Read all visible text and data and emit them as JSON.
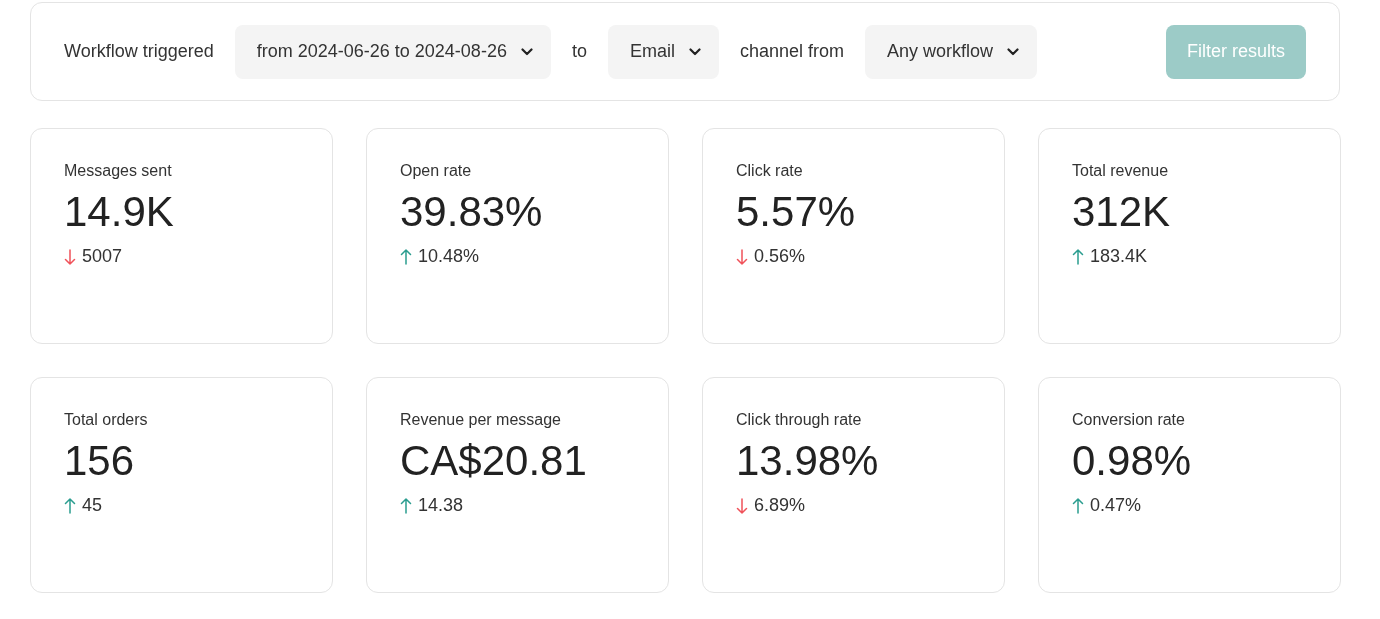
{
  "filter_bar": {
    "items": [
      {
        "kind": "label",
        "text": "Workflow triggered"
      },
      {
        "kind": "dropdown",
        "text": "from 2024-06-26 to 2024-08-26"
      },
      {
        "kind": "label",
        "text": "to"
      },
      {
        "kind": "dropdown",
        "text": "Email"
      },
      {
        "kind": "label",
        "text": "channel from"
      },
      {
        "kind": "dropdown",
        "text": "Any workflow"
      }
    ],
    "button": {
      "label": "Filter results",
      "disabled": true
    }
  },
  "metrics": [
    {
      "label": "Messages sent",
      "value": "14.9K",
      "kind": "down",
      "change": "5007"
    },
    {
      "label": "Open rate",
      "value": "39.83%",
      "kind": "up",
      "change": "10.48%"
    },
    {
      "label": "Click rate",
      "value": "5.57%",
      "kind": "down",
      "change": "0.56%"
    },
    {
      "label": "Total revenue",
      "value": "312K",
      "kind": "up",
      "change": "183.4K"
    },
    {
      "label": "Total orders",
      "value": "156",
      "kind": "up",
      "change": "45"
    },
    {
      "label": "Revenue per message",
      "value": "CA$20.81",
      "kind": "up",
      "change": "14.38"
    },
    {
      "label": "Click through rate",
      "value": "13.98%",
      "kind": "down",
      "change": "6.89%"
    },
    {
      "label": "Conversion rate",
      "value": "0.98%",
      "kind": "up",
      "change": "0.47%"
    }
  ]
}
